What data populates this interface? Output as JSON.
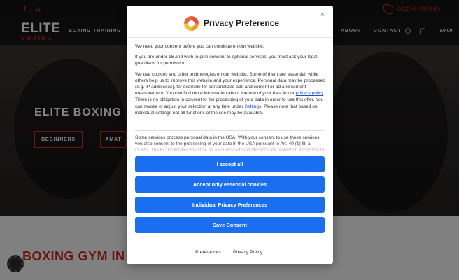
{
  "site": {
    "social_icons": [
      {
        "name": "facebook-icon",
        "glyph": "f"
      },
      {
        "name": "twitter-icon",
        "glyph": "t"
      },
      {
        "name": "instagram-icon",
        "glyph": "◘"
      }
    ],
    "phone": "01204 493560",
    "logo": {
      "main": "ELITE",
      "sub": "BOXING"
    },
    "nav": {
      "boxing_training": "BOXING TRAINING",
      "about": "ABOUT",
      "contact": "CONTACT",
      "cart": "£0.00"
    },
    "hero": {
      "title": "ELITE BOXING",
      "btn_beginners": "BEGINNERS",
      "btn_amateur": "AMAT"
    },
    "lower": {
      "title": "BOXING GYM IN B"
    },
    "colors": {
      "brand_red": "#c4281c",
      "primary_blue": "#1a6ff0"
    }
  },
  "modal": {
    "title": "Privacy Preference",
    "close": "×",
    "p1": "We need your consent before you can continue on our website.",
    "p2": "If you are under 16 and wish to give consent to optional services, you must ask your legal guardians for permission.",
    "p3a": "We use cookies and other technologies on our website. Some of them are essential, while others help us to improve this website and your experience. Personal data may be processed (e.g. IP addresses), for example for personalized ads and content or ad and content measurement. You can find more information about the use of your data in our",
    "p3_link1": "privacy policy",
    "p3b": ". There is no obligation to consent to the processing of your data in order to use this offer. You can revoke or adjust your selection at any time under",
    "p3_link2": "Settings",
    "p3c": ". Please note that based on individual settings not all functions of the site may be available.",
    "p4": "Some services process personal data in the USA. With your consent to use these services, you also consent to the processing of your data in the USA pursuant to Art. 49 (1) lit. a GDPR. The ECJ classifies the USA as a country with insufficient data protection according to EU standards. For example, there is a risk that U.S. authorities will process",
    "buttons": {
      "accept_all": "I accept all",
      "essential_only": "Accept only essential cookies",
      "individual": "Individual Privacy Preferences",
      "save": "Save Consent"
    },
    "footer": {
      "preferences": "Preferences",
      "privacy_policy": "Privacy Policy"
    }
  }
}
